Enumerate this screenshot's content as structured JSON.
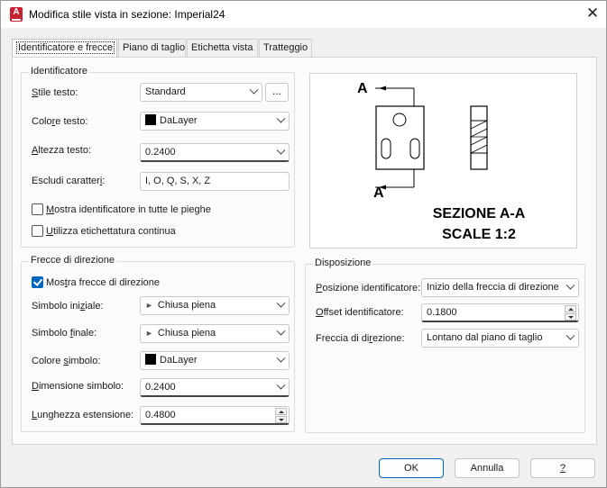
{
  "window": {
    "title": "Modifica stile vista in sezione: Imperial24",
    "app_icon_letter": "A",
    "close_glyph": "✕"
  },
  "tabs": [
    {
      "label": "Identificatore e frecce",
      "active": true
    },
    {
      "label": "Piano di taglio",
      "active": false
    },
    {
      "label": "Etichetta vista",
      "active": false
    },
    {
      "label": "Tratteggio",
      "active": false
    }
  ],
  "identificatore": {
    "legend": "Identificatore",
    "stile_testo": {
      "label_u": "S",
      "label_rest": "tile testo:",
      "value": "Standard",
      "browse": "..."
    },
    "colore_testo": {
      "label_pre": "Colo",
      "label_u": "r",
      "label_rest": "e testo:",
      "value": "DaLayer",
      "swatch_color": "#000000"
    },
    "altezza_testo": {
      "label_u": "A",
      "label_rest": "ltezza testo:",
      "value": "0.2400"
    },
    "escludi_caratteri": {
      "label_pre": "Escludi caratter",
      "label_u": "i",
      "label_rest": ":",
      "value": "I, O, Q, S, X, Z"
    },
    "mostra_pieghe": {
      "label_u": "M",
      "label_rest": "ostra identificatore in tutte le pieghe",
      "checked": false
    },
    "etichettatura_continua": {
      "label_u": "U",
      "label_rest": "tilizza etichettatura continua",
      "checked": false
    }
  },
  "frecce": {
    "legend": "Frecce di direzione",
    "mostra_frecce": {
      "label_pre": "Mos",
      "label_u": "t",
      "label_rest": "ra frecce di direzione",
      "checked": true
    },
    "simbolo_iniziale": {
      "label_pre": "Simbolo ini",
      "label_u": "z",
      "label_rest": "iale:",
      "value": "Chiusa piena"
    },
    "simbolo_finale": {
      "label_pre": "Simbolo ",
      "label_u": "f",
      "label_rest": "inale:",
      "value": "Chiusa piena"
    },
    "colore_simbolo": {
      "label_pre": "Colore ",
      "label_u": "s",
      "label_rest": "imbolo:",
      "value": "DaLayer",
      "swatch_color": "#000000"
    },
    "dimensione_simbolo": {
      "label_u": "D",
      "label_rest": "imensione simbolo:",
      "value": "0.2400"
    },
    "lunghezza_estensione": {
      "label_u": "L",
      "label_rest": "unghezza estensione:",
      "value": "0.4800"
    }
  },
  "preview": {
    "marker_top": "A",
    "marker_bottom": "A",
    "title_line1": "SEZIONE A-A",
    "title_line2": "SCALE 1:2"
  },
  "disposizione": {
    "legend": "Disposizione",
    "posizione": {
      "label_u": "P",
      "label_rest": "osizione identificatore:",
      "value": "Inizio della freccia di direzione"
    },
    "offset": {
      "label_u": "O",
      "label_rest": "ffset identificatore:",
      "value": "0.1800"
    },
    "freccia": {
      "label_pre": "Freccia di di",
      "label_u": "r",
      "label_rest": "ezione:",
      "value": "Lontano dal piano di taglio"
    }
  },
  "buttons": {
    "ok": "OK",
    "annulla": "Annulla",
    "help": "?"
  }
}
